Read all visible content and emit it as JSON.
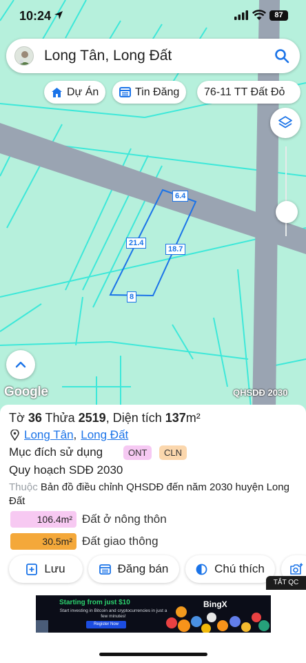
{
  "status_bar": {
    "time": "10:24",
    "battery": "87"
  },
  "search": {
    "value": "Long Tân, Long Đất"
  },
  "chips": [
    {
      "label": "Dự Án",
      "icon": "house-icon"
    },
    {
      "label": "Tin Đăng",
      "icon": "listing-icon"
    },
    {
      "label": "76-11 TT Đất Đỏ",
      "icon": ""
    }
  ],
  "map": {
    "plot_labels": [
      "6.4",
      "21.4",
      "18.7",
      "8"
    ],
    "google_logo": "Google",
    "map_tag": "QHSDĐ 2030",
    "colors": {
      "base": "#b6f0dc",
      "parcel_lines": "#3de8d9",
      "road": "#9aa4b2",
      "selected": "#1a73e8"
    }
  },
  "parcel": {
    "to_label": "Tờ",
    "to_value": "36",
    "thua_label": "Thửa",
    "thua_value": "2519",
    "area_label": ", Diện tích",
    "area_value": "137",
    "area_unit": "m²",
    "location_1": "Long Tân",
    "location_sep": ",",
    "location_2": "Long Đất",
    "purpose_label": "Mục đích sử dụng",
    "purpose_tags": [
      "ONT",
      "CLN"
    ],
    "plan_label": "Quy hoạch SDĐ 2030",
    "belongs_label": "Thuộc",
    "belongs_value": "Bản đồ điều chỉnh QHSDĐ đến năm 2030 huyện Long Đất",
    "areas": [
      {
        "value": "106.4m²",
        "label": "Đất ở nông thôn",
        "color": "#f7c9f2"
      },
      {
        "value": "30.5m²",
        "label": "Đất giao thông",
        "color": "#f4a83a"
      }
    ]
  },
  "actions": [
    {
      "label": "Lưu",
      "icon": "save-icon"
    },
    {
      "label": "Đăng bán",
      "icon": "post-listing-icon"
    },
    {
      "label": "Chú thích",
      "icon": "legend-icon"
    },
    {
      "label": "",
      "icon": "add-photo-icon"
    }
  ],
  "ad_tag": "TẮT QC",
  "ad": {
    "headline": "Starting from just $10",
    "subtext": "Start investing in Bitcoin and cryptocurrencies in just a few minutes!",
    "button": "Register Now",
    "brand": "BingX"
  }
}
